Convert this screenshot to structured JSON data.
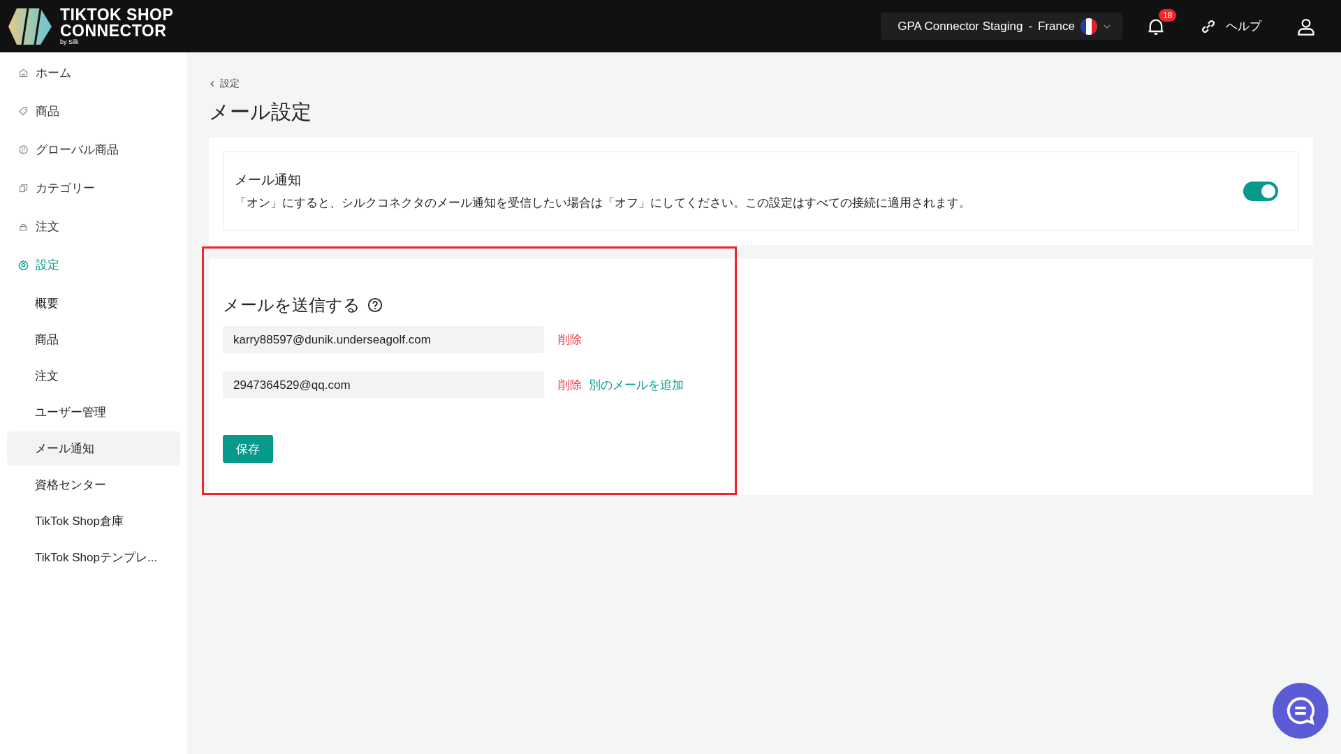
{
  "header": {
    "logo_line1": "TIKTOK SHOP",
    "logo_line2": "CONNECTOR",
    "logo_byline": "by Silk",
    "store": "GPA Connector Staging",
    "separator": "-",
    "country": "France",
    "notification_count": "18",
    "help": "ヘルプ"
  },
  "sidebar": {
    "items": [
      {
        "label": "ホーム",
        "kind": "home",
        "selected": false
      },
      {
        "label": "商品",
        "kind": "tag",
        "selected": false
      },
      {
        "label": "グローバル商品",
        "kind": "globe",
        "selected": false
      },
      {
        "label": "カテゴリー",
        "kind": "copy",
        "selected": false
      },
      {
        "label": "注文",
        "kind": "basket",
        "selected": false
      },
      {
        "label": "設定",
        "kind": "settings",
        "selected": true,
        "children": [
          {
            "label": "概要",
            "selected": false
          },
          {
            "label": "商品",
            "selected": false
          },
          {
            "label": "注文",
            "selected": false
          },
          {
            "label": "ユーザー管理",
            "selected": false
          },
          {
            "label": "メール通知",
            "selected": true
          },
          {
            "label": "資格センター",
            "selected": false
          },
          {
            "label": "TikTok Shop倉庫",
            "selected": false
          },
          {
            "label": "TikTok Shopテンプレ...",
            "selected": false
          }
        ]
      }
    ]
  },
  "breadcrumb": "設定",
  "title": "メール設定",
  "notification_card": {
    "title": "メール通知",
    "description": "「オン」にすると、シルクコネクタのメール通知を受信したい場合は「オフ」にしてください。この設定はすべての接続に適用されます。",
    "on": true
  },
  "send_section": {
    "title": "メールを送信する",
    "highlighted": true,
    "emails": [
      {
        "value": "karry88597@dunik.underseagolf.com",
        "delete": "削除"
      },
      {
        "value": "2947364529@qq.com",
        "delete": "削除",
        "add": "別のメールを追加"
      }
    ],
    "save": "保存"
  }
}
